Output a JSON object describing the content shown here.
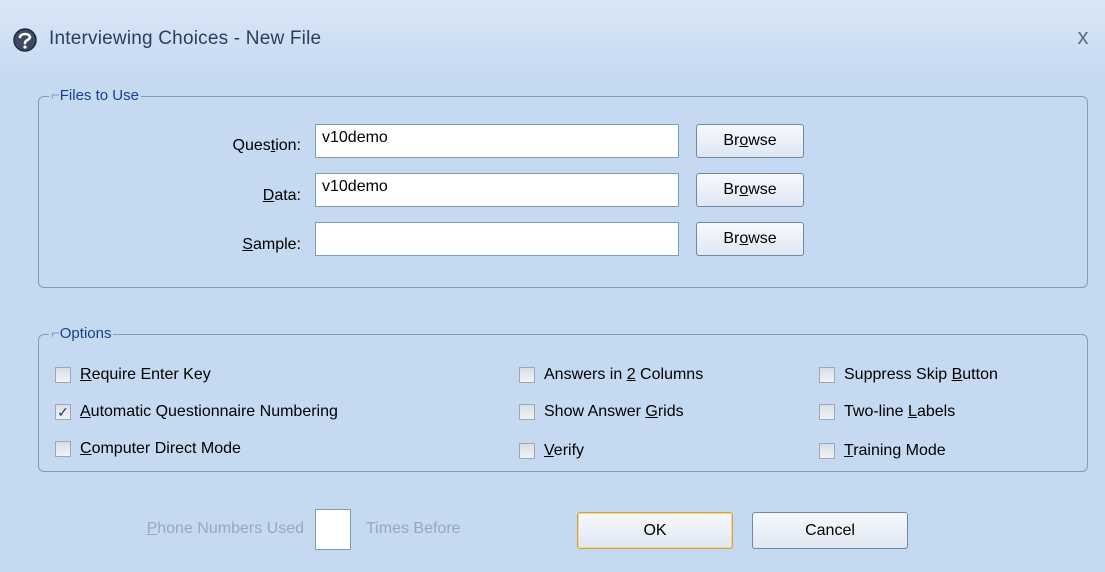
{
  "window": {
    "title": "Interviewing Choices - New File",
    "close_glyph": "x",
    "app_icon": "help-globe-icon"
  },
  "files": {
    "legend": "Files to Use",
    "question": {
      "label_pre": "Ques",
      "label_u": "t",
      "label_post": "ion:",
      "value": "v10demo",
      "browse_pre": "Br",
      "browse_u": "o",
      "browse_post": "wse"
    },
    "data": {
      "label_pre": "",
      "label_u": "D",
      "label_post": "ata:",
      "value": "v10demo",
      "browse_pre": "Br",
      "browse_u": "o",
      "browse_post": "wse"
    },
    "sample": {
      "label_pre": "",
      "label_u": "S",
      "label_post": "ample:",
      "value": "",
      "browse_pre": "Br",
      "browse_u": "o",
      "browse_post": "wse"
    }
  },
  "options": {
    "legend": "Options",
    "items": [
      {
        "pre": "",
        "u": "R",
        "post": "equire Enter Key",
        "checked": false
      },
      {
        "pre": "",
        "u": "A",
        "post": "utomatic Questionnaire Numbering",
        "checked": true
      },
      {
        "pre": "",
        "u": "C",
        "post": "omputer Direct Mode",
        "checked": false
      },
      {
        "pre": "Answers in ",
        "u": "2",
        "post": " Columns",
        "checked": false
      },
      {
        "pre": "Show Answer ",
        "u": "G",
        "post": "rids",
        "checked": false
      },
      {
        "pre": "",
        "u": "V",
        "post": "erify",
        "checked": false
      },
      {
        "pre": "Suppress Skip ",
        "u": "B",
        "post": "utton",
        "checked": false
      },
      {
        "pre": "Two-line ",
        "u": "L",
        "post": "abels",
        "checked": false
      },
      {
        "pre": "",
        "u": "T",
        "post": "raining Mode",
        "checked": false
      }
    ]
  },
  "footer": {
    "phone_pre": "",
    "phone_u": "P",
    "phone_post": "hone Numbers Used",
    "times_before": "Times Before",
    "times_value": "",
    "ok": "OK",
    "cancel": "Cancel"
  },
  "check_glyph": "✓"
}
